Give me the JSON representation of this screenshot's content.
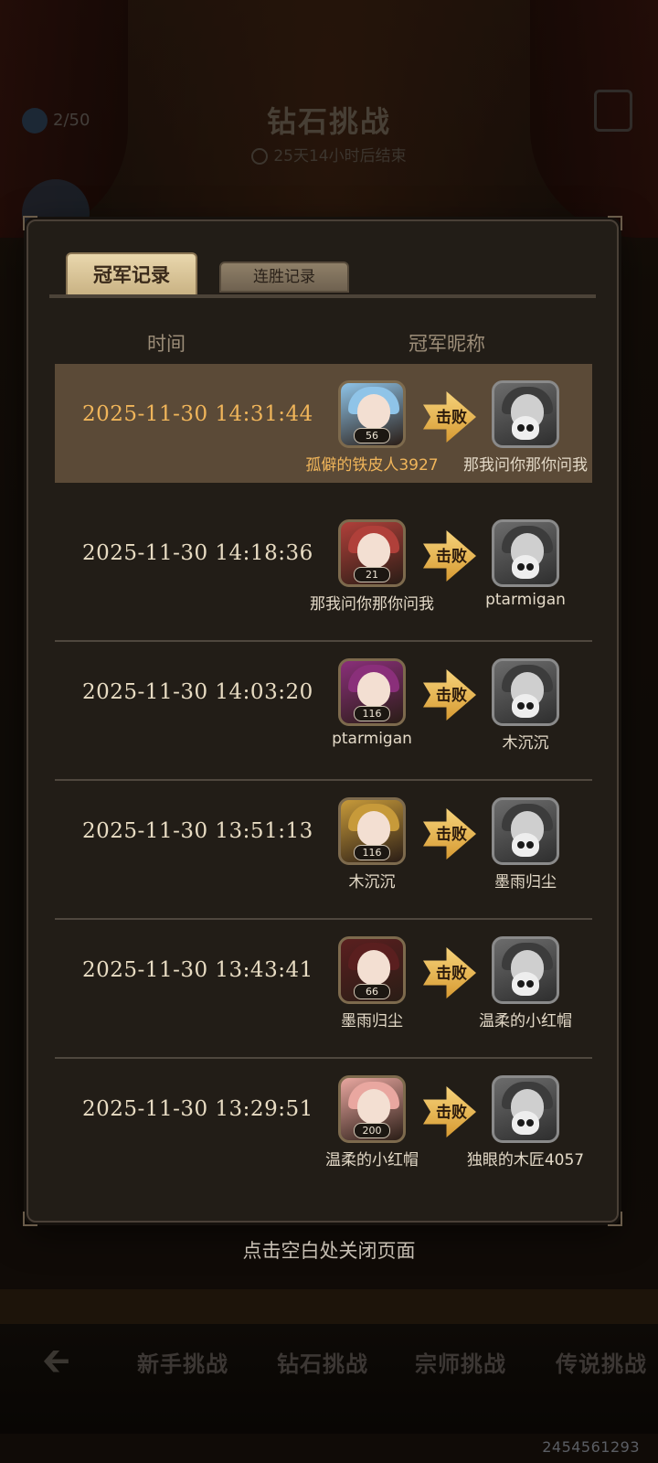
{
  "background": {
    "stamina": "2/50",
    "title": "钻石挑战",
    "timer": "25天14小时后结束",
    "nav": [
      "新手挑战",
      "钻石挑战",
      "宗师挑战",
      "传说挑战"
    ],
    "user_id": "2454561293"
  },
  "modal": {
    "tabs": {
      "active": "冠军记录",
      "inactive": "连胜记录"
    },
    "headers": {
      "time": "时间",
      "name": "冠军昵称"
    },
    "arrow_label": "击败",
    "rows": [
      {
        "time": "2025-11-30  14:31:44",
        "winner": "孤僻的铁皮人3927",
        "winner_level": "56",
        "loser": "那我问你那你问我",
        "highlighted": true
      },
      {
        "time": "2025-11-30  14:18:36",
        "winner": "那我问你那你问我",
        "winner_level": "21",
        "loser": "ptarmigan",
        "highlighted": false
      },
      {
        "time": "2025-11-30  14:03:20",
        "winner": "ptarmigan",
        "winner_level": "116",
        "loser": "木沉沉",
        "highlighted": false
      },
      {
        "time": "2025-11-30  13:51:13",
        "winner": "木沉沉",
        "winner_level": "116",
        "loser": "墨雨归尘",
        "highlighted": false
      },
      {
        "time": "2025-11-30  13:43:41",
        "winner": "墨雨归尘",
        "winner_level": "66",
        "loser": "温柔的小红帽",
        "highlighted": false
      },
      {
        "time": "2025-11-30  13:29:51",
        "winner": "温柔的小红帽",
        "winner_level": "200",
        "loser": "独眼的木匠4057",
        "highlighted": false
      }
    ],
    "close_hint": "点击空白处关闭页面"
  },
  "colors": {
    "highlight_row": "#5b4a37",
    "highlight_text": "#f0b55a",
    "arrow": "#e2ad4a",
    "hair": [
      "#8fc4e8",
      "#b0403a",
      "#8a2f7a",
      "#c79a3a",
      "#5a1f1f",
      "#e9a7a0"
    ]
  }
}
